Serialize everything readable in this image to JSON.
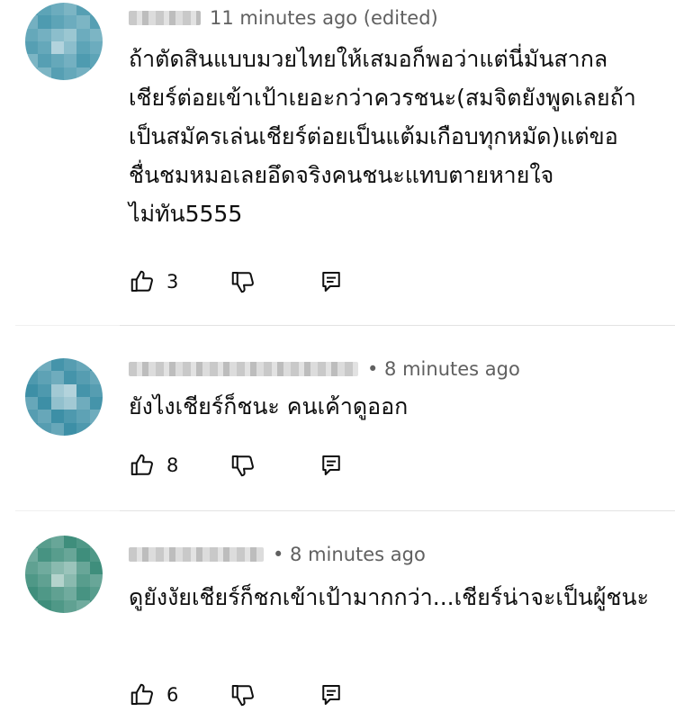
{
  "comments": [
    {
      "time": "11 minutes ago (edited)",
      "text": "ถ้าตัดสินแบบมวยไทยให้เสมอก็พอว่าแต่นี่มันสากล เชียร์ต่อยเข้าเป้าเยอะกว่าควรชนะ(สมจิตยังพูดเลยถ้าเป็นสมัครเล่นเชียร์ต่อยเป็นแต้มเกือบทุกหมัด)แต่ขอชื่นชมหมอเลยอึดจริงคนชนะแทบตายหายใจไม่ทัน5555",
      "likes": "3",
      "avatar_color": "#4e9bb0"
    },
    {
      "time": "• 8 minutes ago",
      "text": "ยังไงเชียร์ก็ชนะ คนเค้าดูออก",
      "likes": "8",
      "avatar_color": "#3d8fa6"
    },
    {
      "time": "• 8 minutes ago",
      "text": "ดูยังงัยเชียร์ก็ชกเข้าเป้ามากกว่า...เชียร์น่าจะเป็นผู้ชนะ",
      "likes": "6",
      "avatar_color": "#3f8e7c"
    }
  ],
  "icons": {
    "like": "thumbs-up-icon",
    "dislike": "thumbs-down-icon",
    "reply": "reply-icon"
  }
}
